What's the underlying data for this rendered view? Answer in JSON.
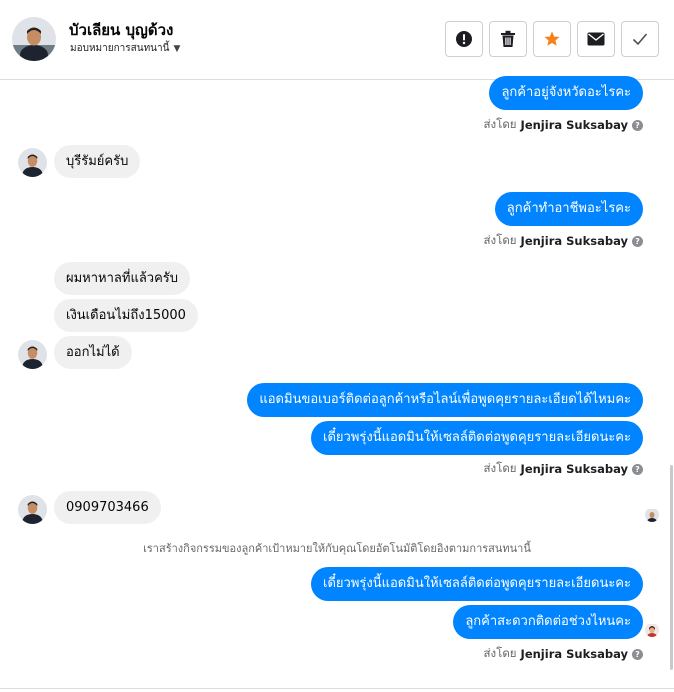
{
  "header": {
    "contact_name": "บัวเลียน บุญด้วง",
    "assign_label": "มอบหมายการสนทนานี้",
    "actions": [
      "mark-spam",
      "delete",
      "star",
      "email",
      "done"
    ]
  },
  "colors": {
    "accent": "#0084ff",
    "incoming": "#f0f0f0",
    "star": "#f5821f"
  },
  "messages": {
    "m1": "ลูกค้าอยู่จังหวัดอะไรคะ",
    "m2": "บุรีรัมย์ครับ",
    "m3": "ลูกค้าทำอาชีพอะไรคะ",
    "m4": "ผมหาหาลที่แล้วครับ",
    "m5": "เงินเดือนไม่ถึง15000",
    "m6": "ออกไม่ได้",
    "m7": "แอดมินขอเบอร์ติดต่อลูกค้าหรือไลน์เพื่อพูดคุยรายละเอียดได้ไหมคะ",
    "m8": "เดี๋ยวพรุ่งนี้แอดมินให้เซลล์ติดต่อพูดคุยรายละเอียดนะคะ",
    "m9": "0909703466",
    "m10": "เดี๋ยวพรุ่งนี้แอดมินให้เซลล์ติดต่อพูดคุยรายละเอียดนะคะ",
    "m11": "ลูกค้าสะดวกติดต่อช่วงไหนคะ"
  },
  "sent_by": {
    "prefix": "ส่งโดย",
    "agent": "Jenjira Suksabay"
  },
  "system_note": "เราสร้างกิจกรรมของลูกค้าเป้าหมายให้กับคุณโดยอัตโนมัติโดยอิงตามการสนทนานี้"
}
